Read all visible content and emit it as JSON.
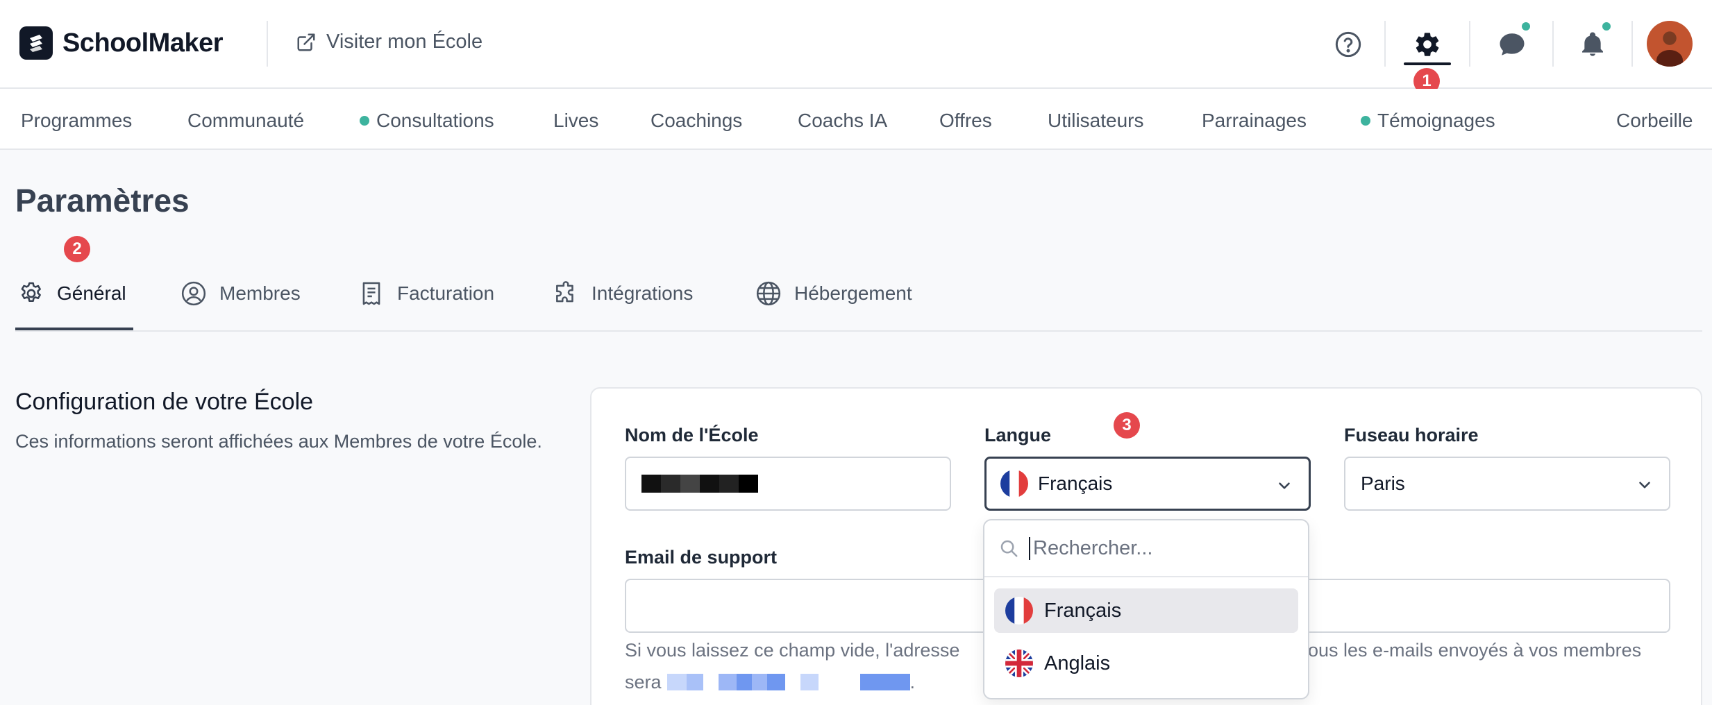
{
  "header": {
    "brand": "SchoolMaker",
    "visit_link": "Visiter mon École",
    "icons": [
      "help-icon",
      "gear-icon",
      "chat-icon",
      "bell-icon"
    ],
    "badge_1": "1"
  },
  "nav": {
    "items": [
      {
        "label": "Programmes",
        "dot": false
      },
      {
        "label": "Communauté",
        "dot": false
      },
      {
        "label": "Consultations",
        "dot": true
      },
      {
        "label": "Lives",
        "dot": false
      },
      {
        "label": "Coachings",
        "dot": false
      },
      {
        "label": "Coachs IA",
        "dot": false
      },
      {
        "label": "Offres",
        "dot": false
      },
      {
        "label": "Utilisateurs",
        "dot": false
      },
      {
        "label": "Parrainages",
        "dot": false
      },
      {
        "label": "Témoignages",
        "dot": true
      },
      {
        "label": "Corbeille",
        "dot": false
      }
    ]
  },
  "page": {
    "title": "Paramètres",
    "badge_2": "2",
    "tabs": [
      {
        "label": "Général",
        "icon": "gear-icon",
        "active": true
      },
      {
        "label": "Membres",
        "icon": "user-circle-icon",
        "active": false
      },
      {
        "label": "Facturation",
        "icon": "receipt-icon",
        "active": false
      },
      {
        "label": "Intégrations",
        "icon": "puzzle-icon",
        "active": false
      },
      {
        "label": "Hébergement",
        "icon": "globe-icon",
        "active": false
      }
    ]
  },
  "config": {
    "title": "Configuration de votre École",
    "description": "Ces informations seront affichées aux Membres de votre École.",
    "school_name_label": "Nom de l'École",
    "language_label": "Langue",
    "language_value": "Français",
    "badge_3": "3",
    "timezone_label": "Fuseau horaire",
    "timezone_value": "Paris",
    "support_email_label": "Email de support",
    "support_email_value": "",
    "help_text_start": "Si vous laissez ce champ vide, l'adresse",
    "help_text_end": "ous les e-mails envoyés à vos membres",
    "help_text_line2": "sera",
    "help_text_line2_end": "."
  },
  "dropdown": {
    "search_placeholder": "Rechercher...",
    "options": [
      {
        "label": "Français",
        "flag": "fr",
        "selected": true
      },
      {
        "label": "Anglais",
        "flag": "gb",
        "selected": false
      }
    ]
  },
  "colors": {
    "accent_dark": "#111827",
    "badge_red": "#e5484d",
    "online_green": "#3db39e"
  }
}
